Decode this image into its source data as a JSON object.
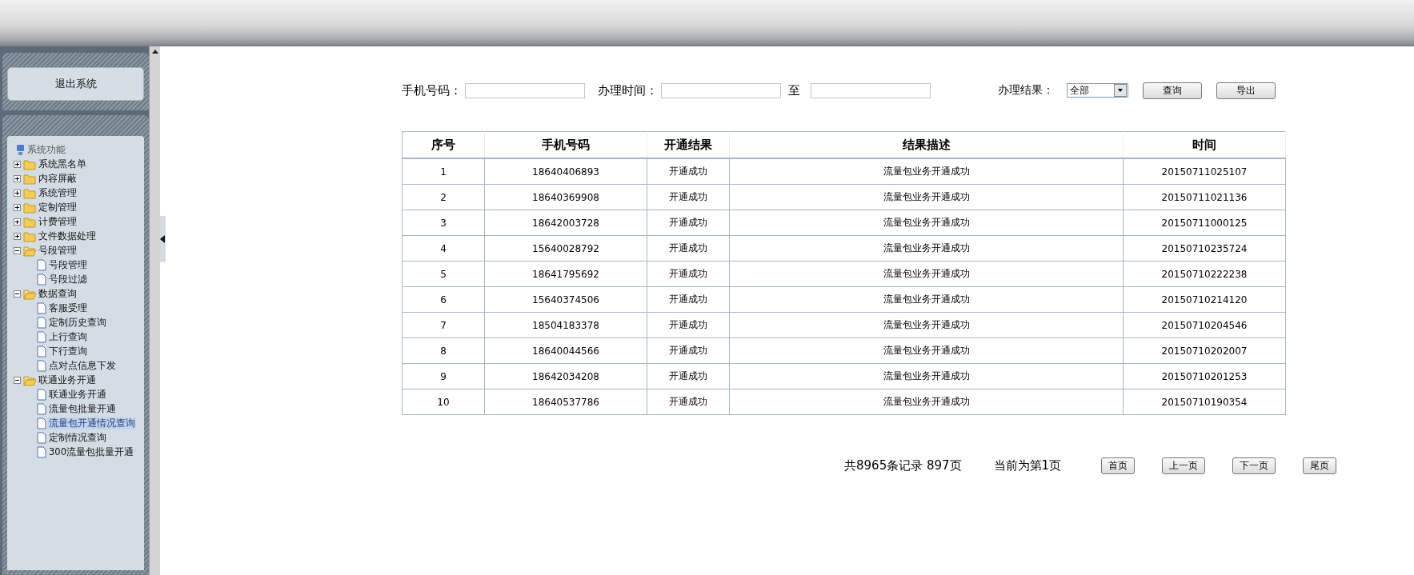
{
  "sidebar": {
    "logout_button": "退出系统",
    "tree": {
      "label": "系统功能",
      "children": [
        {
          "label": "系统黑名单",
          "expanded": false
        },
        {
          "label": "内容屏蔽",
          "expanded": false
        },
        {
          "label": "系统管理",
          "expanded": false
        },
        {
          "label": "定制管理",
          "expanded": false
        },
        {
          "label": "计费管理",
          "expanded": false
        },
        {
          "label": "文件数据处理",
          "expanded": false
        },
        {
          "label": "号段管理",
          "expanded": true,
          "children": [
            {
              "label": "号段管理",
              "selected": false
            },
            {
              "label": "号段过滤",
              "selected": false
            }
          ]
        },
        {
          "label": "数据查询",
          "expanded": true,
          "children": [
            {
              "label": "客服受理",
              "selected": false
            },
            {
              "label": "定制历史查询",
              "selected": false
            },
            {
              "label": "上行查询",
              "selected": false
            },
            {
              "label": "下行查询",
              "selected": false
            },
            {
              "label": "点对点信息下发",
              "selected": false
            }
          ]
        },
        {
          "label": "联通业务开通",
          "expanded": true,
          "children": [
            {
              "label": "联通业务开通",
              "selected": false
            },
            {
              "label": "流量包批量开通",
              "selected": false
            },
            {
              "label": "流量包开通情况查询",
              "selected": true
            },
            {
              "label": "定制情况查询",
              "selected": false
            },
            {
              "label": "300流量包批量开通",
              "selected": false
            }
          ]
        }
      ]
    }
  },
  "filters": {
    "phone_label": "手机号码：",
    "time_label": "办理时间：",
    "to_label": "至",
    "result_label": "办理结果：",
    "result_value": "全部",
    "query_button": "查询",
    "export_button": "导出"
  },
  "table": {
    "columns": [
      "序号",
      "手机号码",
      "开通结果",
      "结果描述",
      "时间"
    ],
    "rows": [
      [
        "1",
        "18640406893",
        "开通成功",
        "流量包业务开通成功",
        "20150711025107"
      ],
      [
        "2",
        "18640369908",
        "开通成功",
        "流量包业务开通成功",
        "20150711021136"
      ],
      [
        "3",
        "18642003728",
        "开通成功",
        "流量包业务开通成功",
        "20150711000125"
      ],
      [
        "4",
        "15640028792",
        "开通成功",
        "流量包业务开通成功",
        "20150710235724"
      ],
      [
        "5",
        "18641795692",
        "开通成功",
        "流量包业务开通成功",
        "20150710222238"
      ],
      [
        "6",
        "15640374506",
        "开通成功",
        "流量包业务开通成功",
        "20150710214120"
      ],
      [
        "7",
        "18504183378",
        "开通成功",
        "流量包业务开通成功",
        "20150710204546"
      ],
      [
        "8",
        "18640044566",
        "开通成功",
        "流量包业务开通成功",
        "20150710202007"
      ],
      [
        "9",
        "18642034208",
        "开通成功",
        "流量包业务开通成功",
        "20150710201253"
      ],
      [
        "10",
        "18640537786",
        "开通成功",
        "流量包业务开通成功",
        "20150710190354"
      ]
    ]
  },
  "pagination": {
    "summary": "共8965条记录 897页",
    "current": "当前为第1页",
    "buttons": [
      "首页",
      "上一页",
      "下一页",
      "尾页"
    ]
  }
}
